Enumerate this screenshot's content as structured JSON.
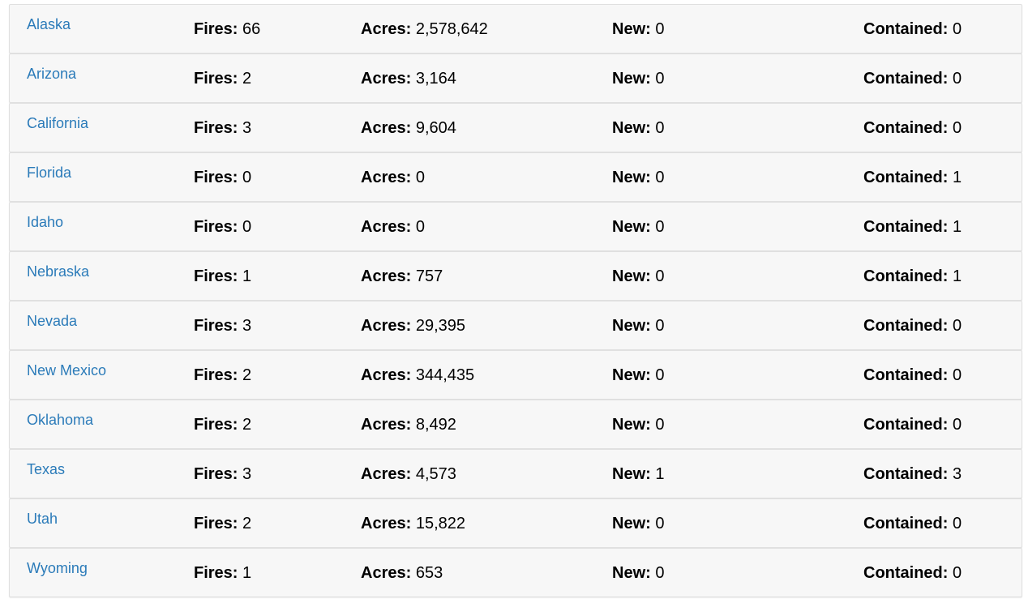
{
  "labels": {
    "fires": "Fires:",
    "acres": "Acres:",
    "new": "New:",
    "contained": "Contained:"
  },
  "link_color": "#2b7bb9",
  "rows": [
    {
      "state": "Alaska",
      "fires": "66",
      "acres": "2,578,642",
      "new": "0",
      "contained": "0"
    },
    {
      "state": "Arizona",
      "fires": "2",
      "acres": "3,164",
      "new": "0",
      "contained": "0"
    },
    {
      "state": "California",
      "fires": "3",
      "acres": "9,604",
      "new": "0",
      "contained": "0"
    },
    {
      "state": "Florida",
      "fires": "0",
      "acres": "0",
      "new": "0",
      "contained": "1"
    },
    {
      "state": "Idaho",
      "fires": "0",
      "acres": "0",
      "new": "0",
      "contained": "1"
    },
    {
      "state": "Nebraska",
      "fires": "1",
      "acres": "757",
      "new": "0",
      "contained": "1"
    },
    {
      "state": "Nevada",
      "fires": "3",
      "acres": "29,395",
      "new": "0",
      "contained": "0"
    },
    {
      "state": "New Mexico",
      "fires": "2",
      "acres": "344,435",
      "new": "0",
      "contained": "0"
    },
    {
      "state": "Oklahoma",
      "fires": "2",
      "acres": "8,492",
      "new": "0",
      "contained": "0"
    },
    {
      "state": "Texas",
      "fires": "3",
      "acres": "4,573",
      "new": "1",
      "contained": "3"
    },
    {
      "state": "Utah",
      "fires": "2",
      "acres": "15,822",
      "new": "0",
      "contained": "0"
    },
    {
      "state": "Wyoming",
      "fires": "1",
      "acres": "653",
      "new": "0",
      "contained": "0"
    }
  ]
}
